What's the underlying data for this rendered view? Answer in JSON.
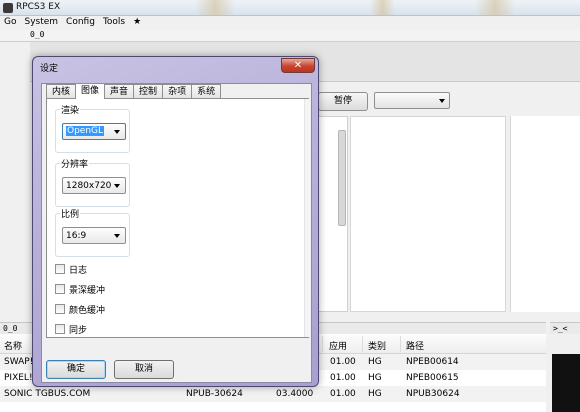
{
  "window": {
    "title": "RPCS3 EX"
  },
  "menu": [
    "Go",
    "System",
    "Config",
    "Tools",
    "★"
  ],
  "toolbar": {
    "label": "0_0"
  },
  "controls": {
    "pause_label": "暂停"
  },
  "dialog": {
    "title": "设定",
    "close_label": "✕",
    "tabs": [
      "内核",
      "图像",
      "声音",
      "控制",
      "杂项",
      "系统"
    ],
    "active_tab": "图像",
    "groups": {
      "render": {
        "label": "渲染",
        "value": "OpenGL"
      },
      "resolution": {
        "label": "分辨率",
        "value": "1280x720"
      },
      "aspect": {
        "label": "比例",
        "value": "16:9"
      }
    },
    "checkboxes": [
      "日志",
      "景深缓冲",
      "颜色缓冲",
      "同步"
    ],
    "ok_label": "确定",
    "cancel_label": "取消"
  },
  "game_list": {
    "dock_title": "0_0",
    "side_dock_title": ">_<",
    "columns": [
      "名称",
      "应用",
      "类别",
      "路径"
    ],
    "rows": [
      {
        "name": "SWAP!",
        "serial": "",
        "firmware": "",
        "app": "01.00",
        "category": "HG",
        "path": "NPEB00614"
      },
      {
        "name": "PIXEL!",
        "serial": "",
        "firmware": "",
        "app": "01.00",
        "category": "HG",
        "path": "NPEB00615"
      },
      {
        "name": "SONIC TGBUS.COM",
        "serial": "NPUB-30624",
        "firmware": "03.4000",
        "app": "01.00",
        "category": "HG",
        "path": "NPUB30624"
      }
    ]
  }
}
